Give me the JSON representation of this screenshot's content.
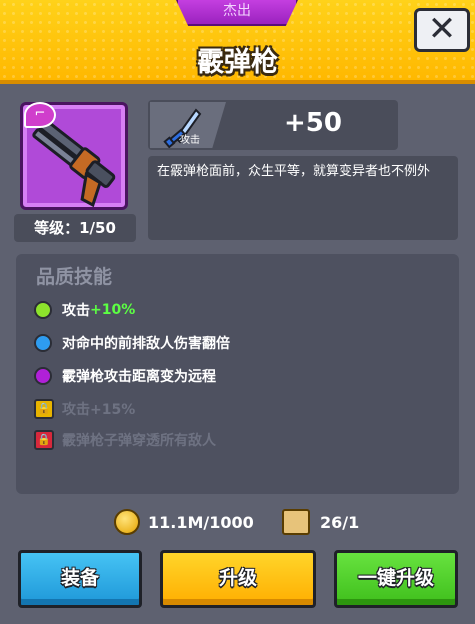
{
  "header": {
    "rarity": "杰出",
    "title": "霰弹枪",
    "close_icon": "close-icon"
  },
  "item": {
    "icon": "shotgun-icon",
    "badge_icon": "pistol-badge-icon",
    "level_text": "等级：1/50"
  },
  "stat": {
    "icon": "sword-icon",
    "label": "攻击",
    "value": "+50"
  },
  "description": "在霰弹枪面前，众生平等，就算变异者也不例外",
  "skills": {
    "title": "品质技能",
    "items": [
      {
        "text": "攻击",
        "bonus": "+10%",
        "color": "#8de32c",
        "unlocked": true
      },
      {
        "text": "对命中的前排敌人伤害翻倍",
        "bonus": "",
        "color": "#2e9cf0",
        "unlocked": true
      },
      {
        "text": "霰弹枪攻击距离变为远程",
        "bonus": "",
        "color": "#b020d8",
        "unlocked": true
      },
      {
        "text": "攻击+15%",
        "bonus": "",
        "color": "#e8b400",
        "unlocked": false
      },
      {
        "text": "霰弹枪子弹穿透所有敌人",
        "bonus": "",
        "color": "#d7283c",
        "unlocked": false
      }
    ]
  },
  "costs": {
    "coins": "11.1M/1000",
    "coin_icon": "gold-coin-icon",
    "scrolls": "26/1",
    "scroll_icon": "blueprint-scroll-icon"
  },
  "buttons": {
    "equip": "装备",
    "upgrade": "升级",
    "one_click_upgrade": "一键升级"
  }
}
